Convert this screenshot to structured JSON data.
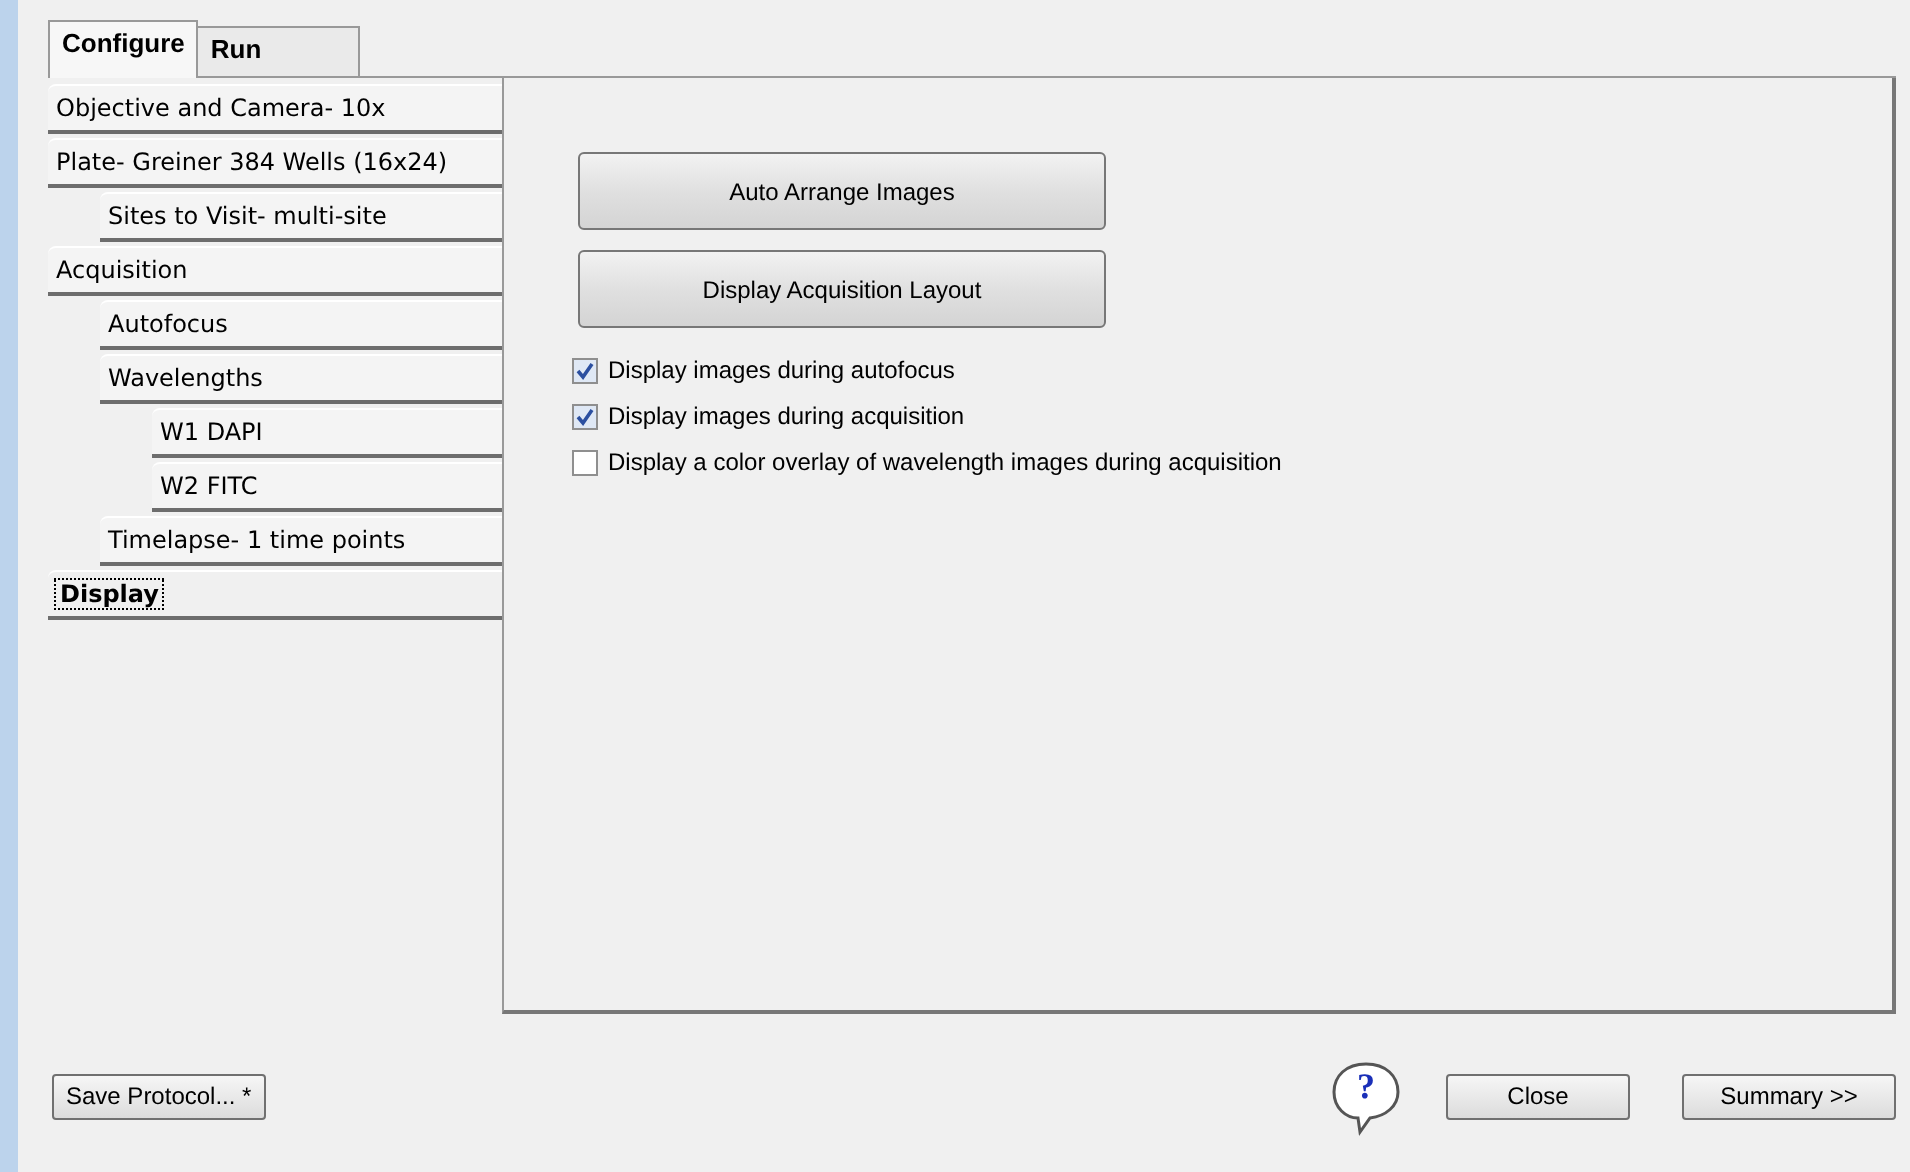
{
  "tabs": [
    {
      "label": "Configure",
      "selected": true
    },
    {
      "label": "Run",
      "selected": false
    }
  ],
  "nav": [
    {
      "label": "Objective and Camera- 10x",
      "selected": false
    },
    {
      "label": "Plate- Greiner 384 Wells (16x24)",
      "selected": false,
      "children": [
        {
          "label": "Sites to Visit- multi-site",
          "selected": false
        }
      ]
    },
    {
      "label": "Acquisition",
      "selected": false,
      "children": [
        {
          "label": "Autofocus",
          "selected": false
        },
        {
          "label": "Wavelengths",
          "selected": false,
          "children": [
            {
              "label": "W1 DAPI",
              "selected": false
            },
            {
              "label": "W2 FITC",
              "selected": false
            }
          ]
        },
        {
          "label": "Timelapse- 1 time points",
          "selected": false
        }
      ]
    },
    {
      "label": "Display",
      "selected": true
    }
  ],
  "buttons": [
    "Auto Arrange Images",
    "Display Acquisition Layout"
  ],
  "options": [
    {
      "label": "Display images during autofocus",
      "checked": true
    },
    {
      "label": "Display images during acquisition",
      "checked": true
    },
    {
      "label": "Display a color overlay of wavelength images during acquisition",
      "checked": false
    }
  ],
  "footer": {
    "save": "Save Protocol... *",
    "help": "?",
    "close": "Close",
    "summary": "Summary >>"
  }
}
